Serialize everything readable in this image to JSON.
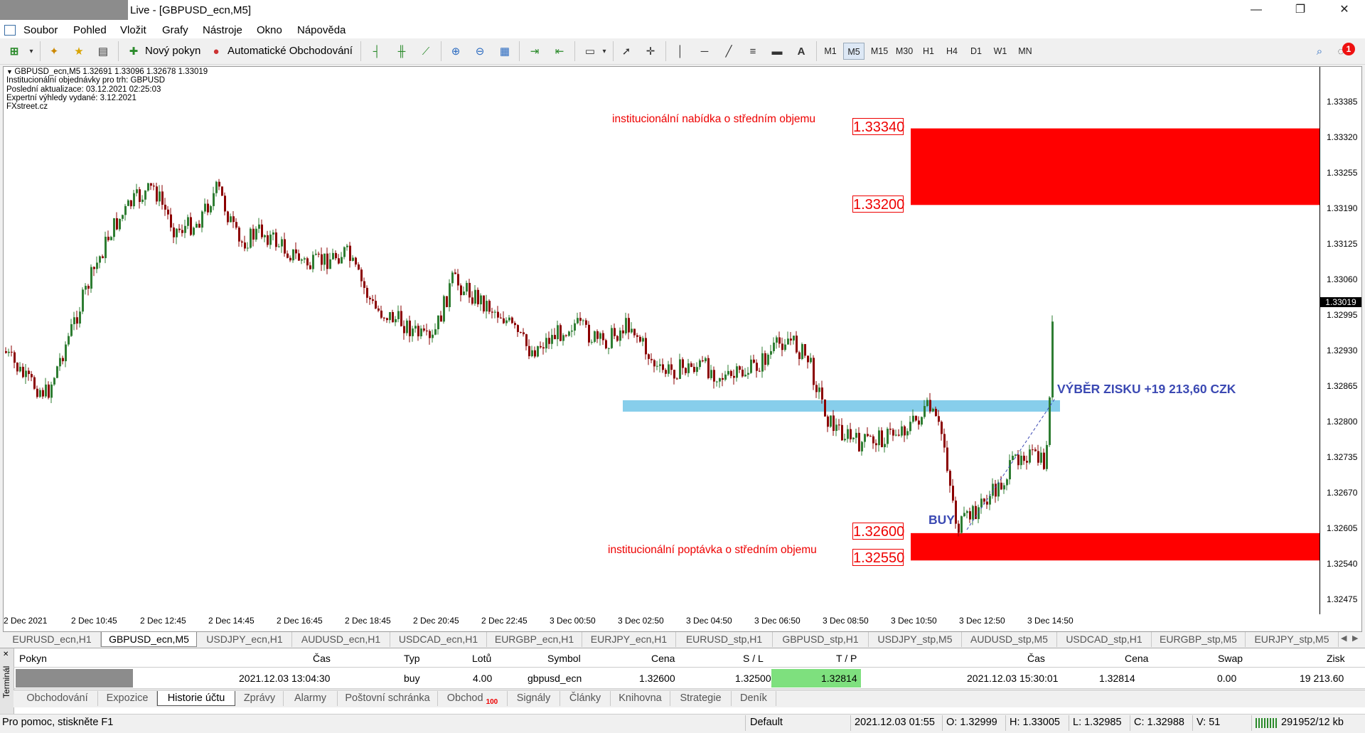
{
  "window": {
    "title": "Live - [GBPUSD_ecn,M5]",
    "controls": {
      "minimize": "—",
      "restore": "❐",
      "close": "✕"
    }
  },
  "menu": [
    "Soubor",
    "Pohled",
    "Vložit",
    "Grafy",
    "Nástroje",
    "Okno",
    "Nápověda"
  ],
  "toolbar": {
    "new_order": "Nový pokyn",
    "auto_trading": "Automatické Obchodování",
    "timeframes": [
      "M1",
      "M5",
      "M15",
      "M30",
      "H1",
      "H4",
      "D1",
      "W1",
      "MN"
    ],
    "active_timeframe": "M5",
    "text_tool": "A",
    "notification_count": "1"
  },
  "chart": {
    "info_lines": [
      "GBPUSD_ecn,M5  1.32691 1.33096 1.32678 1.33019",
      "Institucionální objednávky pro trh: GBPUSD",
      "Poslední aktualizace: 03.12.2021 02:25:03",
      "Expertní výhledy vydané: 3.12.2021",
      "FXstreet.cz"
    ],
    "current_price": "1.33019",
    "price_ticks": [
      "1.33385",
      "1.33320",
      "1.33255",
      "1.33190",
      "1.33125",
      "1.33060",
      "1.32995",
      "1.32930",
      "1.32865",
      "1.32800",
      "1.32735",
      "1.32670",
      "1.32605",
      "1.32540",
      "1.32475"
    ],
    "time_ticks": [
      "2 Dec 2021",
      "2 Dec 10:45",
      "2 Dec 12:45",
      "2 Dec 14:45",
      "2 Dec 16:45",
      "2 Dec 18:45",
      "2 Dec 20:45",
      "2 Dec 22:45",
      "3 Dec 00:50",
      "3 Dec 02:50",
      "3 Dec 04:50",
      "3 Dec 06:50",
      "3 Dec 08:50",
      "3 Dec 10:50",
      "3 Dec 12:50",
      "3 Dec 14:50"
    ],
    "supply_zone": {
      "label": "institucionální nabídka o středním objemu",
      "top": "1.33340",
      "bottom": "1.33200"
    },
    "demand_zone": {
      "label": "institucionální poptávka o středním objemu",
      "top": "1.32600",
      "bottom": "1.32550"
    },
    "buy_label": "BUY",
    "profit_label": "VÝBĚR ZISKU +19 213,60 CZK",
    "colors": {
      "zone": "#ff0000",
      "bull": "#2e7d32",
      "bear": "#8b0000",
      "support_line": "#87ceeb",
      "annotation": "#3b49b3"
    }
  },
  "symbol_tabs": [
    "EURUSD_ecn,H1",
    "GBPUSD_ecn,M5",
    "USDJPY_ecn,H1",
    "AUDUSD_ecn,H1",
    "USDCAD_ecn,H1",
    "EURGBP_ecn,H1",
    "EURJPY_ecn,H1",
    "EURUSD_stp,H1",
    "GBPUSD_stp,H1",
    "USDJPY_stp,M5",
    "AUDUSD_stp,M5",
    "USDCAD_stp,H1",
    "EURGBP_stp,M5",
    "EURJPY_stp,M5"
  ],
  "active_symbol_tab": "GBPUSD_ecn,M5",
  "terminal": {
    "side_label": "Terminál",
    "headers": [
      "Pokyn",
      "Čas",
      "Typ",
      "Lotů",
      "Symbol",
      "Cena",
      "S / L",
      "T / P",
      "Čas",
      "Cena",
      "Swap",
      "Zisk"
    ],
    "row": {
      "open_time": "2021.12.03 13:04:30",
      "type": "buy",
      "lots": "4.00",
      "symbol": "gbpusd_ecn",
      "open_price": "1.32600",
      "sl": "1.32500",
      "tp": "1.32814",
      "close_time": "2021.12.03 15:30:01",
      "close_price": "1.32814",
      "swap": "0.00",
      "profit": "19 213.60"
    },
    "tabs": [
      "Obchodování",
      "Expozice",
      "Historie účtu",
      "Zprávy",
      "Alarmy",
      "Poštovní schránka",
      "Obchod",
      "Signály",
      "Články",
      "Knihovna",
      "Strategie",
      "Deník"
    ],
    "trade_badge": "100",
    "active_tab": "Historie účtu"
  },
  "status": {
    "help": "Pro pomoc, stiskněte F1",
    "profile": "Default",
    "time": "2021.12.03 01:55",
    "open": "O: 1.32999",
    "high": "H: 1.33005",
    "low": "L: 1.32985",
    "close": "C: 1.32988",
    "volume": "V: 51",
    "traffic": "291952/12 kb"
  }
}
